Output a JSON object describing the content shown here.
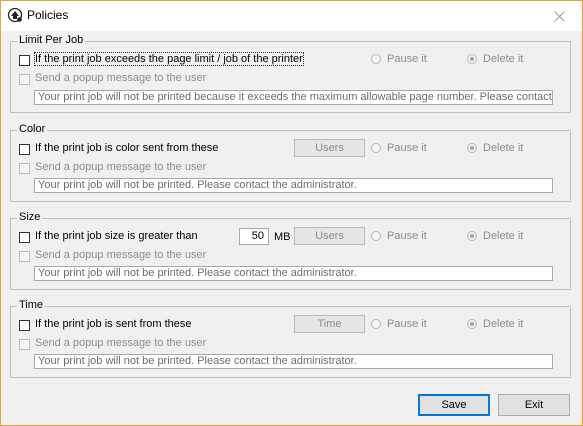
{
  "window": {
    "title": "Policies"
  },
  "groups": {
    "limit": {
      "legend": "Limit Per Job",
      "condition_label": "If the print job exceeds the page limit / job of the printer",
      "pause_label": "Pause it",
      "delete_label": "Delete it",
      "popup_label": "Send a popup message to the user",
      "message": "Your print job will not be printed because it exceeds the maximum allowable page number. Please contact the administrator."
    },
    "color": {
      "legend": "Color",
      "condition_label": "If the print job is color sent from these",
      "users_button": "Users",
      "pause_label": "Pause it",
      "delete_label": "Delete it",
      "popup_label": "Send a popup message to the user",
      "message": "Your print job will not be printed. Please contact the administrator."
    },
    "size": {
      "legend": "Size",
      "condition_label": "If the print job size is greater than",
      "size_value": "50",
      "size_unit": "MB",
      "users_button": "Users",
      "pause_label": "Pause it",
      "delete_label": "Delete it",
      "popup_label": "Send a popup message to the user",
      "message": "Your print job will not be printed. Please contact the administrator."
    },
    "time": {
      "legend": "Time",
      "condition_label": "If the print job is sent from these",
      "time_button": "Time",
      "pause_label": "Pause it",
      "delete_label": "Delete it",
      "popup_label": "Send a popup message to the user",
      "message": "Your print job will not be printed. Please contact the administrator."
    }
  },
  "footer": {
    "save_label": "Save",
    "exit_label": "Exit"
  }
}
